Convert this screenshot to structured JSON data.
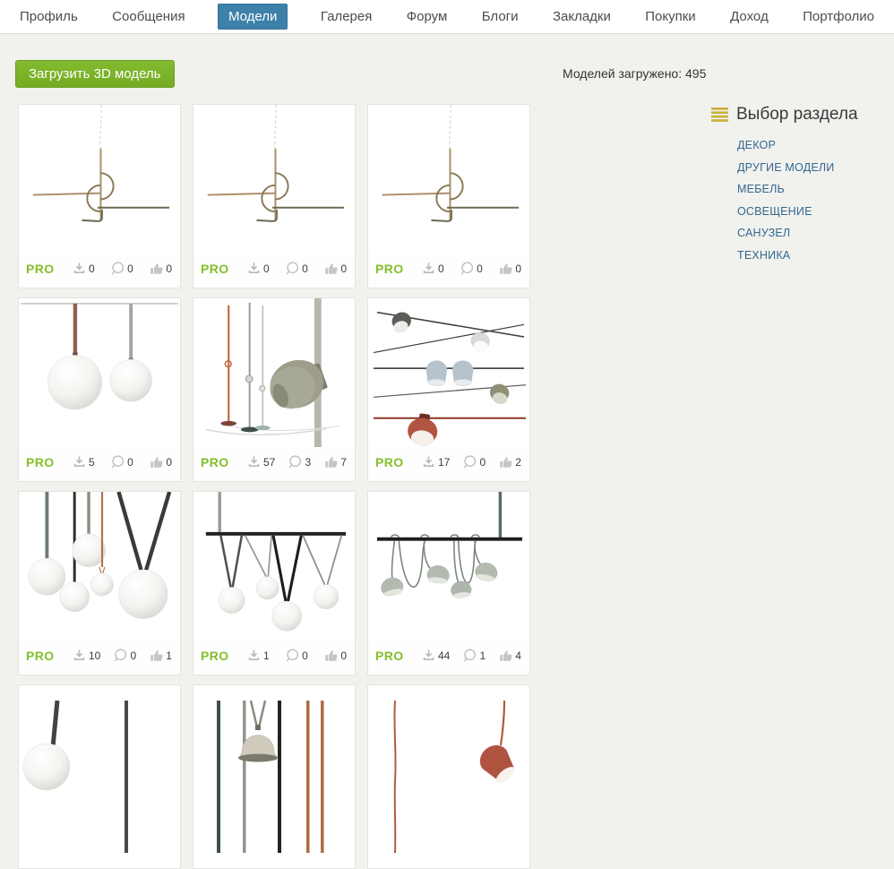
{
  "nav": {
    "items": [
      "Профиль",
      "Сообщения",
      "Модели",
      "Галерея",
      "Форум",
      "Блоги",
      "Закладки",
      "Покупки",
      "Доход",
      "Портфолио"
    ],
    "active_item": "Модели"
  },
  "toolbar": {
    "upload_button": "Загрузить 3D модель",
    "models_loaded": "Моделей загружено: 495"
  },
  "sidebar": {
    "menu_icon": "hamburger-icon",
    "title": "Выбор раздела",
    "items": [
      "ДЕКОР",
      "ДРУГИЕ МОДЕЛИ",
      "МЕБЕЛЬ",
      "ОСВЕЩЕНИЕ",
      "САНУЗЕЛ",
      "ТЕХНИКА"
    ]
  },
  "cards": [
    {
      "badge": "PRO",
      "downloads": "0",
      "comments": "0",
      "likes": "0",
      "thumb": "wire-line-wall-lamp"
    },
    {
      "badge": "PRO",
      "downloads": "0",
      "comments": "0",
      "likes": "0",
      "thumb": "wire-line-wall-lamp"
    },
    {
      "badge": "PRO",
      "downloads": "0",
      "comments": "0",
      "likes": "0",
      "thumb": "wire-line-wall-lamp"
    },
    {
      "badge": "PRO",
      "downloads": "5",
      "comments": "0",
      "likes": "0",
      "thumb": "sphere-pendants-pair"
    },
    {
      "badge": "PRO",
      "downloads": "57",
      "comments": "3",
      "likes": "7",
      "thumb": "floor-lamps-and-spot"
    },
    {
      "badge": "PRO",
      "downloads": "17",
      "comments": "0",
      "likes": "2",
      "thumb": "cable-spotlights"
    },
    {
      "badge": "PRO",
      "downloads": "10",
      "comments": "0",
      "likes": "1",
      "thumb": "sphere-pendant-cluster"
    },
    {
      "badge": "PRO",
      "downloads": "1",
      "comments": "0",
      "likes": "0",
      "thumb": "bar-sphere-pendants"
    },
    {
      "badge": "PRO",
      "downloads": "44",
      "comments": "1",
      "likes": "4",
      "thumb": "bar-cord-dome-pendants"
    },
    {
      "thumb": "sphere-pendant-partial"
    },
    {
      "thumb": "bell-pendant-with-straps-partial"
    },
    {
      "thumb": "red-cone-pendant-partial"
    }
  ],
  "colors": {
    "accent_green": "#7cb328",
    "pro_green": "#84bf2b",
    "active_tab_blue": "#3d80a8",
    "link_blue": "#33688e",
    "menu_icon_yellow": "#c7ae3a"
  }
}
